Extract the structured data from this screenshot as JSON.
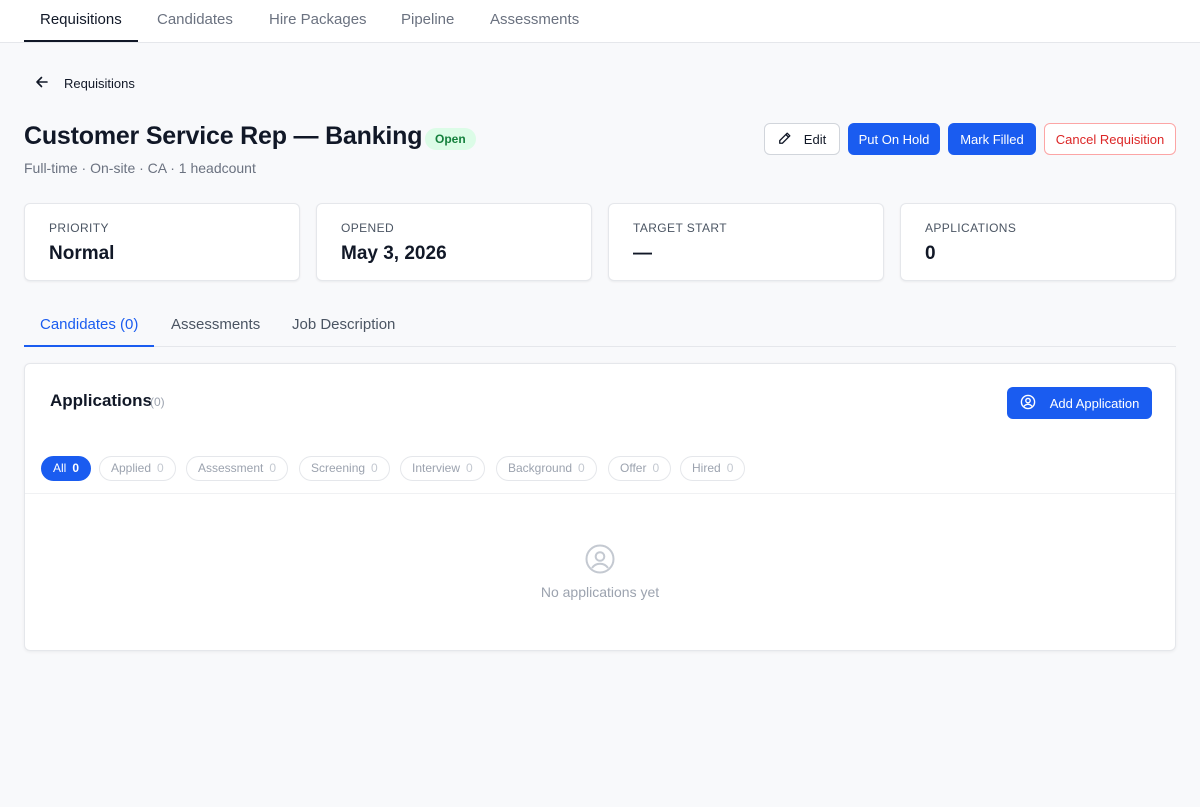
{
  "top_tabs": [
    "Requisitions",
    "Candidates",
    "Hire Packages",
    "Pipeline",
    "Assessments"
  ],
  "back_label": "Requisitions",
  "title": "Customer Service Rep — Banking",
  "status_badge": "Open",
  "subtitle": "Full-time · On-site · CA · 1 headcount",
  "actions": {
    "edit": "Edit",
    "put_on_hold": "Put On Hold",
    "mark_filled": "Mark Filled",
    "cancel": "Cancel Requisition"
  },
  "stats": [
    {
      "label": "PRIORITY",
      "value": "Normal"
    },
    {
      "label": "OPENED",
      "value": "May 3, 2026"
    },
    {
      "label": "TARGET START",
      "value": "—"
    },
    {
      "label": "APPLICATIONS",
      "value": "0"
    }
  ],
  "sub_tabs": [
    "Candidates (0)",
    "Assessments",
    "Job Description"
  ],
  "applications": {
    "title": "Applications",
    "count": "(0)",
    "add_button": "Add Application",
    "filters": [
      {
        "label": "All",
        "count": "0"
      },
      {
        "label": "Applied",
        "count": "0"
      },
      {
        "label": "Assessment",
        "count": "0"
      },
      {
        "label": "Screening",
        "count": "0"
      },
      {
        "label": "Interview",
        "count": "0"
      },
      {
        "label": "Background",
        "count": "0"
      },
      {
        "label": "Offer",
        "count": "0"
      },
      {
        "label": "Hired",
        "count": "0"
      }
    ],
    "empty_text": "No applications yet"
  },
  "colors": {
    "primary": "#1a5cf0",
    "danger": "#dc2626",
    "success_bg": "#dcfce7",
    "success_text": "#15803d"
  },
  "icons": {
    "back": "arrow-left-icon",
    "edit": "pencil-icon",
    "add": "user-circle-icon",
    "empty": "user-circle-icon"
  }
}
